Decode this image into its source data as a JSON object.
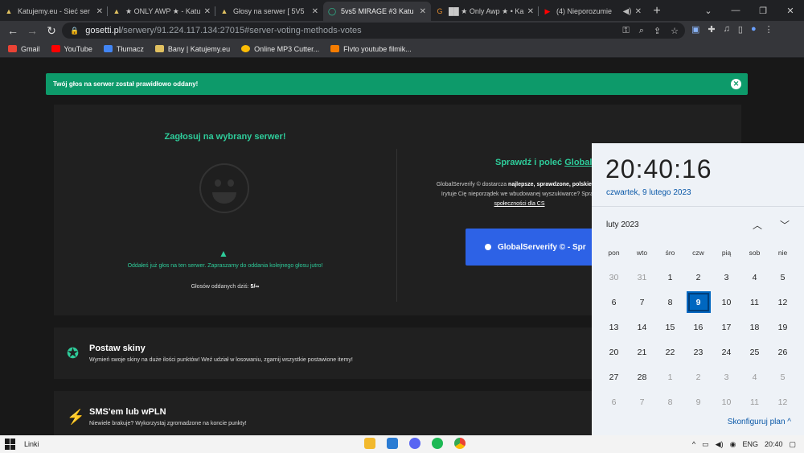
{
  "tabs": [
    {
      "title": "Katujemy.eu - Sieć ser",
      "favicon": "katujemy-icon",
      "color": "#e0c060"
    },
    {
      "title": "★ ONLY AWP ★ - Katu",
      "favicon": "katujemy-icon",
      "color": "#e0c060"
    },
    {
      "title": "Głosy na serwer [ 5V5",
      "favicon": "katujemy-icon",
      "color": "#e0c060"
    },
    {
      "title": "5vs5 MIRAGE #3 Katu",
      "favicon": "globalserverify-icon",
      "color": "#2ecc9a"
    },
    {
      "title": "██ ★ Only Awp ★ • Ka",
      "favicon": "gametracker-icon",
      "color": "#e08a2e"
    },
    {
      "title": "(4) Nieporozumie",
      "favicon": "youtube-icon",
      "color": "#ff0000"
    }
  ],
  "address": {
    "host": "gosetti.pl",
    "path": "/serwery/91.224.117.134:27015#server-voting-methods-votes"
  },
  "bookmarks": [
    {
      "label": "Gmail",
      "color": "#ea4335"
    },
    {
      "label": "YouTube",
      "color": "#ff0000"
    },
    {
      "label": "Tłumacz",
      "color": "#4285f4"
    },
    {
      "label": "Bany | Katujemy.eu",
      "color": "#e0c060"
    },
    {
      "label": "Online MP3 Cutter...",
      "color": "#fbbc05"
    },
    {
      "label": "Flvto youtube filmik...",
      "color": "#f57c00"
    }
  ],
  "alert": {
    "text": "Twój głos na serwer został prawidłowo oddany!"
  },
  "vote": {
    "title": "Zagłosuj na wybrany serwer!",
    "message": "Oddałeś już głos na ten serwer. Zapraszamy do oddania kolejnego głosu jutro!",
    "count_label": "Głosów oddanych dziś:",
    "count_value": "5/∞"
  },
  "gs": {
    "title_prefix": "Sprawdź i poleć",
    "title_link": "Global",
    "desc_1": "GlobalServerify © dostarcza",
    "desc_bold": "najlepsze, sprawdzone, polskie i za",
    "desc_2": "Irytuje Cię nieporządek we wbudowanej wyszukiwarce? Spraw",
    "desc_link": "społeczności dla CS",
    "button": "GlobalServerify © - Spr"
  },
  "features": [
    {
      "title": "Postaw skiny",
      "desc": "Wymień swoje skiny na duże ilości punktów! Weź udział w losowaniu, zgarnij wszystkie postawione itemy!",
      "icon": "award-icon"
    },
    {
      "title": "SMS'em lub wPLN",
      "desc": "Niewiele brakuje? Wykorzystaj zgromadzone na koncie punkty!",
      "icon": "lightning-icon"
    }
  ],
  "calendar": {
    "time": "20:40:16",
    "date": "czwartek, 9 lutego 2023",
    "month": "luty 2023",
    "weekdays": [
      "pon",
      "wto",
      "śro",
      "czw",
      "pią",
      "sob",
      "nie"
    ],
    "days": [
      [
        "30",
        "31",
        "1",
        "2",
        "3",
        "4",
        "5"
      ],
      [
        "6",
        "7",
        "8",
        "9",
        "10",
        "11",
        "12"
      ],
      [
        "13",
        "14",
        "15",
        "16",
        "17",
        "18",
        "19"
      ],
      [
        "20",
        "21",
        "22",
        "23",
        "24",
        "25",
        "26"
      ],
      [
        "27",
        "28",
        "1",
        "2",
        "3",
        "4",
        "5"
      ],
      [
        "6",
        "7",
        "8",
        "9",
        "10",
        "11",
        "12"
      ]
    ],
    "configure": "Skonfiguruj plan"
  },
  "taskbar": {
    "label": "Linki",
    "lang": "ENG",
    "clock": "20:40"
  }
}
